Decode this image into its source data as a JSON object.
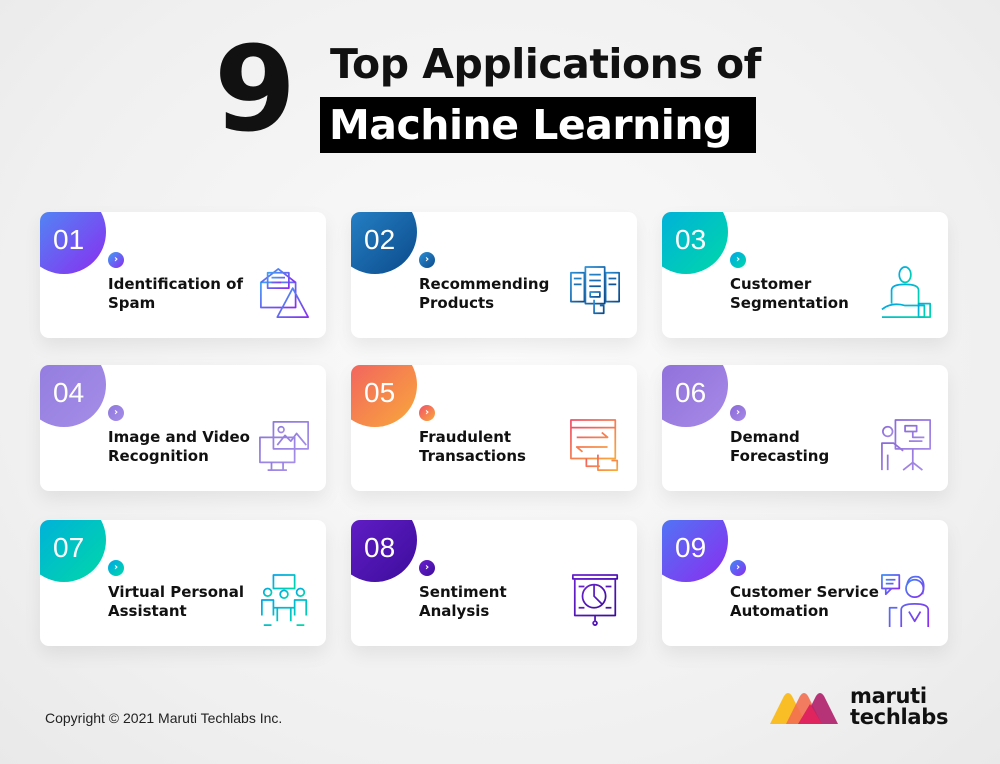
{
  "header": {
    "number": "9",
    "line1": "Top Applications of",
    "line2": "Machine Learning"
  },
  "cards": [
    {
      "num": "01",
      "label": "Identification of Spam",
      "icon": "spam-email-warning-icon",
      "colors": [
        "#3fa0f5",
        "#8b2cf0"
      ]
    },
    {
      "num": "02",
      "label": "Recommending Products",
      "icon": "product-recommendation-icon",
      "colors": [
        "#2c8fd6",
        "#0b4a8a"
      ]
    },
    {
      "num": "03",
      "label": "Customer Segmentation",
      "icon": "customer-hand-icon",
      "colors": [
        "#00a6e8",
        "#00d8a8"
      ]
    },
    {
      "num": "04",
      "label": "Image and Video Recognition",
      "icon": "image-monitor-icon",
      "colors": [
        "#8e78dc",
        "#a58ee8"
      ]
    },
    {
      "num": "05",
      "label": "Fraudulent Transactions",
      "icon": "transaction-monitor-icon",
      "colors": [
        "#f0506a",
        "#f9a93a"
      ]
    },
    {
      "num": "06",
      "label": "Demand Forecasting",
      "icon": "presentation-board-icon",
      "colors": [
        "#8a6ad8",
        "#a68ae6"
      ]
    },
    {
      "num": "07",
      "label": "Virtual Personal Assistant",
      "icon": "meeting-assistant-icon",
      "colors": [
        "#00a6e8",
        "#00d8a8"
      ]
    },
    {
      "num": "08",
      "label": "Sentiment Analysis",
      "icon": "pie-chart-board-icon",
      "colors": [
        "#6a22d0",
        "#3d0c9c"
      ]
    },
    {
      "num": "09",
      "label": "Customer Service Automation",
      "icon": "support-agent-icon",
      "colors": [
        "#3f8af5",
        "#8b2cf0"
      ]
    }
  ],
  "footer": {
    "copyright": "Copyright © 2021 Maruti Techlabs Inc.",
    "logo_line1": "maruti",
    "logo_line2": "techlabs",
    "logo_colors": [
      "#f9b91a",
      "#f26f4f",
      "#e0245e",
      "#b01e6a"
    ]
  }
}
